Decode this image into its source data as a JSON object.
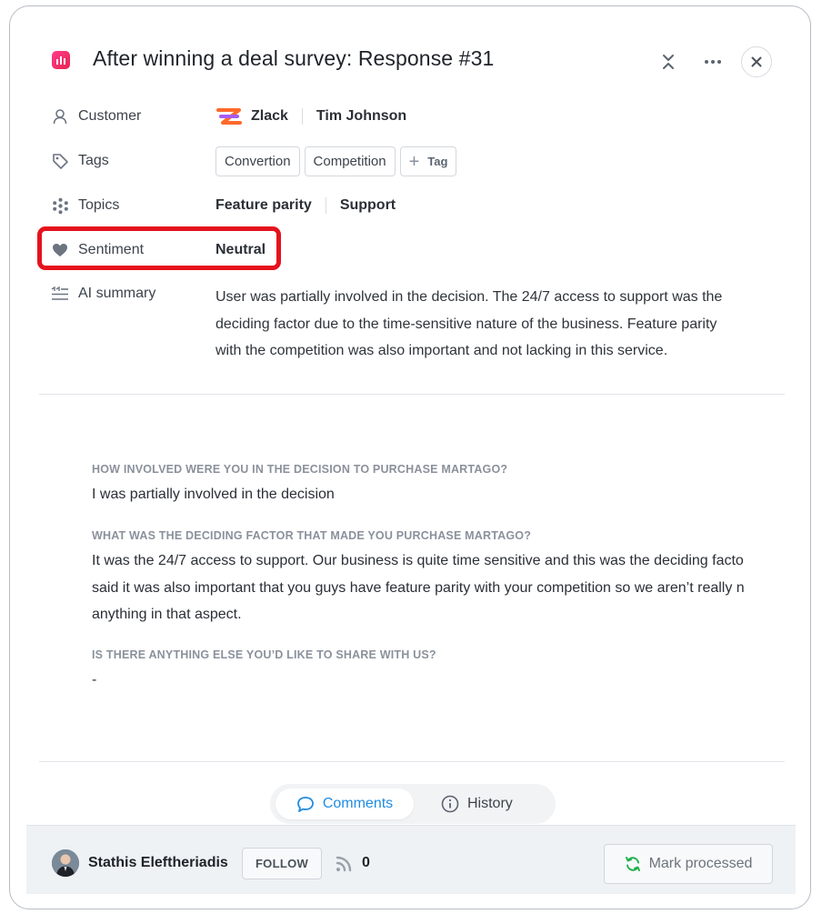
{
  "header": {
    "title": "After winning a deal survey: Response #31",
    "app_icon": "survey-chart-icon",
    "actions": [
      "collapse-icon",
      "more-icon",
      "close-icon"
    ]
  },
  "properties": {
    "customer": {
      "label": "Customer",
      "company": "Zlack",
      "contact": "Tim Johnson"
    },
    "tags": {
      "label": "Tags",
      "items": [
        "Convertion",
        "Competition"
      ],
      "add_label": "Tag"
    },
    "topics": {
      "label": "Topics",
      "items": [
        "Feature parity",
        "Support"
      ]
    },
    "sentiment": {
      "label": "Sentiment",
      "value": "Neutral"
    },
    "ai_summary": {
      "label": "AI summary",
      "lines": [
        "User was partially involved in the decision. The 24/7 access to support was the",
        "deciding factor due to the time-sensitive nature of the business. Feature parity",
        "with the competition was also important and not lacking in this service."
      ]
    }
  },
  "questions": [
    {
      "question": "HOW INVOLVED WERE YOU IN THE DECISION TO PURCHASE MARTAGO?",
      "answer_lines": [
        "I was partially involved in the decision"
      ]
    },
    {
      "question": "WHAT WAS THE DECIDING FACTOR THAT MADE YOU PURCHASE MARTAGO?",
      "answer_lines": [
        "It was the 24/7 access to support. Our business is quite time sensitive and this was the deciding facto",
        "said it was also important that you guys have feature parity with your competition so we aren’t really n",
        "anything in that aspect."
      ]
    },
    {
      "question": "IS THERE ANYTHING ELSE YOU’D LIKE TO SHARE WITH US?",
      "answer_lines": [
        "-"
      ]
    }
  ],
  "tabs": {
    "comments": "Comments",
    "history": "History",
    "active": "comments"
  },
  "footer": {
    "user_name": "Stathis Eleftheriadis",
    "follow_label": "FOLLOW",
    "signal_count": "0",
    "mark_processed_label": "Mark processed"
  },
  "colors": {
    "accent_blue": "#1f8ce0",
    "highlight_red": "#e5121d",
    "app_icon_pink": "#ff3d8b",
    "processed_green": "#22b14c"
  }
}
